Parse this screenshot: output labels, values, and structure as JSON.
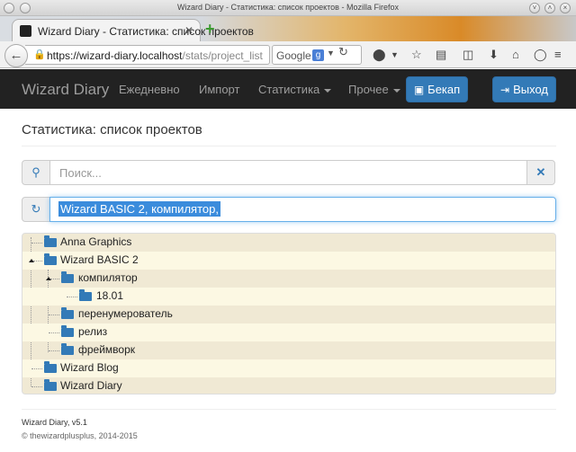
{
  "window": {
    "title": "Wizard Diary - Статистика: список проектов - Mozilla Firefox"
  },
  "browser": {
    "tab_label": "Wizard Diary - Статистика: список проектов",
    "url_host": "https://wizard-diary.localhost",
    "url_path": "/stats/project_list",
    "search_engine": "Google"
  },
  "navbar": {
    "brand": "Wizard Diary",
    "links": [
      "Ежедневно",
      "Импорт",
      "Статистика",
      "Прочее"
    ],
    "backup_label": "Бекап",
    "logout_label": "Выход"
  },
  "page": {
    "title": "Статистика: список проектов",
    "search_placeholder": "Поиск...",
    "selected_path": "Wizard BASIC 2, компилятор,"
  },
  "tree": [
    {
      "label": "Anna Graphics",
      "level": 0
    },
    {
      "label": "Wizard BASIC 2",
      "level": 0,
      "expanded": true
    },
    {
      "label": "компилятор",
      "level": 1,
      "expanded": true
    },
    {
      "label": "18.01",
      "level": 2
    },
    {
      "label": "перенумерователь",
      "level": 1
    },
    {
      "label": "релиз",
      "level": 1
    },
    {
      "label": "фреймворк",
      "level": 1
    },
    {
      "label": "Wizard Blog",
      "level": 0
    },
    {
      "label": "Wizard Diary",
      "level": 0
    }
  ],
  "footer": {
    "version": "Wizard Diary, v5.1",
    "copyright": "© thewizardplusplus, 2014-2015"
  },
  "colors": {
    "navbar": "#222222",
    "primary": "#337ab7",
    "tree_row": "#f0e9d4",
    "tree_row_alt": "#fcf8e3"
  }
}
